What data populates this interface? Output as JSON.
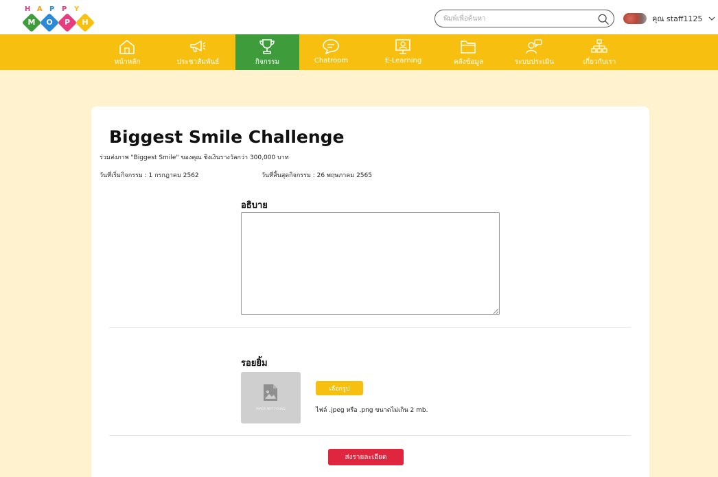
{
  "brand": {
    "top_letters": [
      "H",
      "A",
      "P",
      "P",
      "Y"
    ],
    "bottom_letters": [
      "M",
      "O",
      "P",
      "H"
    ],
    "top_colors": [
      "#e73c7e",
      "#f39c12",
      "#2a8ad8",
      "#e73c7e",
      "#f7c010"
    ],
    "bottom_colors": [
      "#3e9d3a",
      "#2a8ad8",
      "#e73c7e",
      "#f7c010"
    ]
  },
  "search": {
    "placeholder": "พิมพ์เพื่อค้นหา",
    "icon": "search-icon"
  },
  "user": {
    "name": "คุณ staff1125",
    "icon": "chevron-down-icon"
  },
  "nav": {
    "items": [
      {
        "label": "หน้าหลัก",
        "icon": "home-icon"
      },
      {
        "label": "ประชาสัมพันธ์",
        "icon": "megaphone-icon"
      },
      {
        "label": "กิจกรรม",
        "icon": "trophy-icon",
        "active": true
      },
      {
        "label": "Chatroom",
        "icon": "chat-icon"
      },
      {
        "label": "E-Learning",
        "icon": "elearning-icon"
      },
      {
        "label": "คลังข้อมูล",
        "icon": "folder-icon"
      },
      {
        "label": "ระบบประเมิน",
        "icon": "evaluation-icon"
      },
      {
        "label": "เกี่ยวกับเรา",
        "icon": "org-chart-icon"
      }
    ]
  },
  "activity": {
    "title": "Biggest Smile Challenge",
    "subtitle": "ร่วมส่งภาพ \"Biggest Smile\" ของคุณ ชิงเงินรางวัลกว่า 300,000 บาท",
    "start_date": "วันที่เริ่มกิจกรรม : 1 กรกฎาคม 2562",
    "end_date": "วันที่สิ้นสุดกิจกรรม : 26 พฤษภาคม 2565"
  },
  "form": {
    "description_label": "อธิบาย",
    "description_value": "",
    "smile_label": "รอยยิ้ม",
    "image_placeholder_text": "IMAGE NOT FOUND",
    "choose_button": "เลือกรูป",
    "file_hint": "ไฟล์ .jpeg หรือ .png ขนาดไม่เกิน 2 mb.",
    "submit_button": "ส่งรายละเอียด"
  },
  "colors": {
    "nav_bg": "#f7c010",
    "nav_active": "#3e9d3a",
    "page_bg": "#fff3cf",
    "submit": "#e0253f",
    "choose": "#f7c010"
  }
}
